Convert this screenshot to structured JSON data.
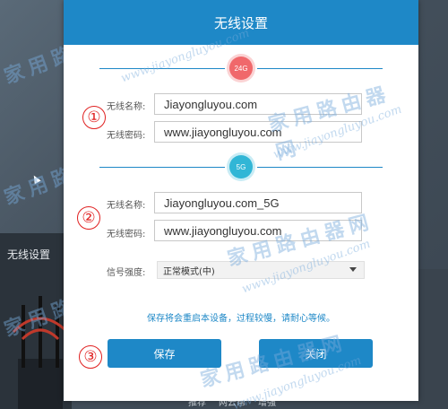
{
  "dialog": {
    "title": "无线设置",
    "band_24": {
      "badge": "24G",
      "ssid_label": "无线名称:",
      "ssid_value": "Jiayongluyou.com",
      "password_label": "无线密码:",
      "password_value": "www.jiayongluyou.com"
    },
    "band_5": {
      "badge": "5G",
      "ssid_label": "无线名称:",
      "ssid_value": "Jiayongluyou.com_5G",
      "password_label": "无线密码:",
      "password_value": "www.jiayongluyou.com"
    },
    "signal": {
      "label": "信号强度:",
      "selected": "正常模式(中)"
    },
    "notice": "保存将会重启本设备，过程较慢，请耐心等候。",
    "save_label": "保存",
    "close_label": "关闭"
  },
  "markers": [
    "①",
    "②",
    "③"
  ],
  "background": {
    "panel_title": "无线设置",
    "tabs": [
      "推荐",
      "网云帮",
      "增强"
    ]
  },
  "watermarks": {
    "cn": "家用路由器网",
    "url": "www.jiayongluyou.com"
  },
  "colors": {
    "accent": "#1e88c7",
    "badge_24": "#f0686b",
    "badge_5": "#31b6d6",
    "marker": "#e02020"
  }
}
